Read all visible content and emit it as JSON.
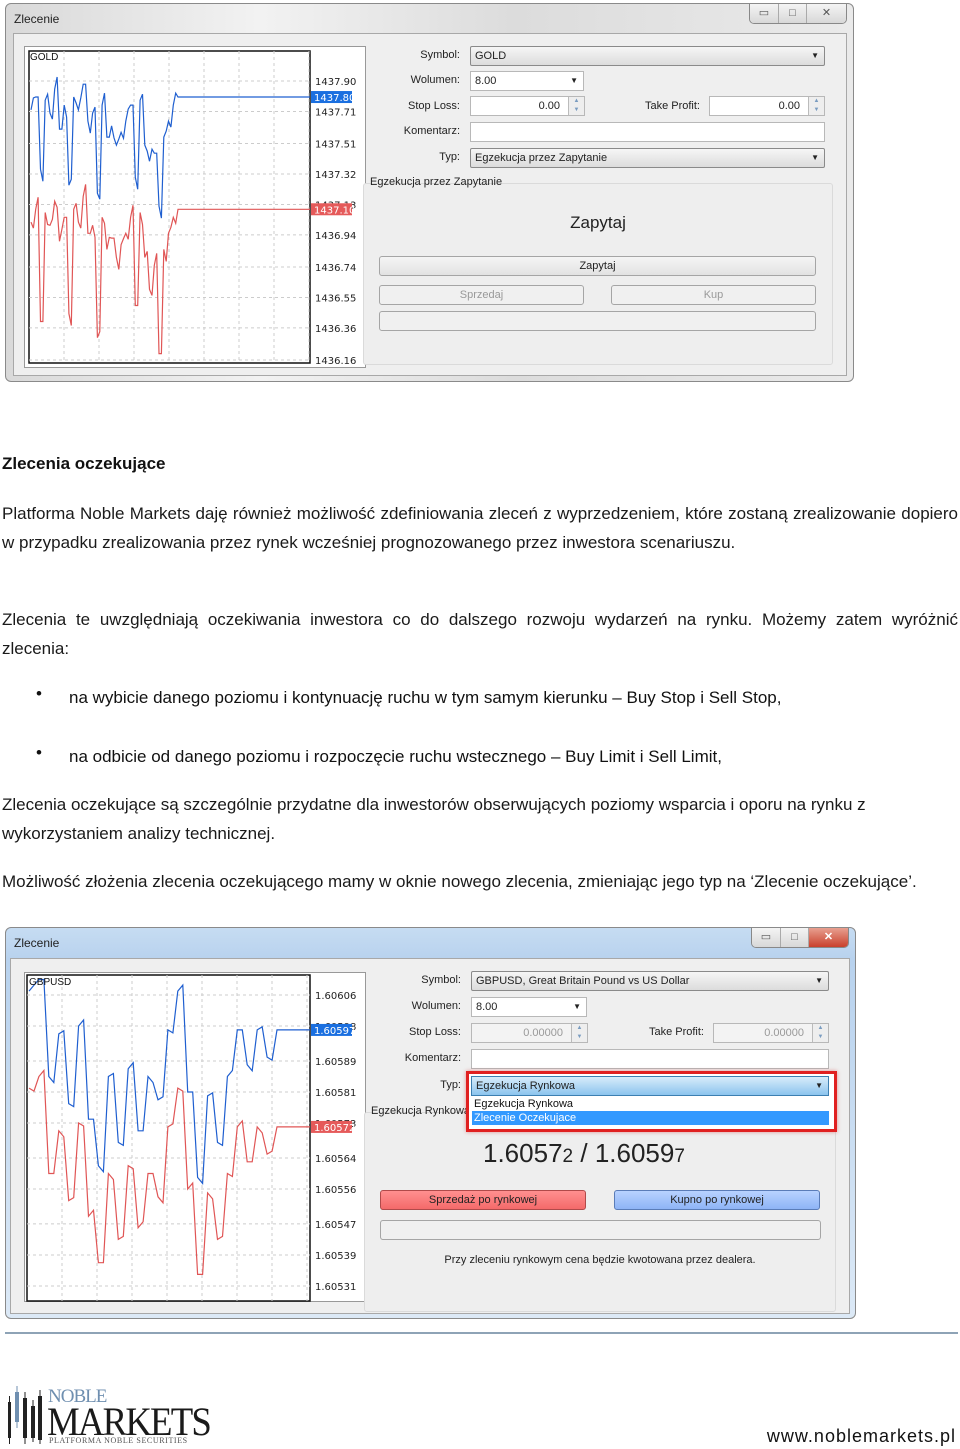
{
  "dialog1": {
    "title": "Zlecenie",
    "controls": {
      "minimize": "▭",
      "maximize": "□",
      "close": "✕"
    },
    "chart": {
      "symbol": "GOLD",
      "price_ticks": [
        "1437.90",
        "1437.71",
        "1437.51",
        "1437.32",
        "1437.13",
        "1436.94",
        "1436.74",
        "1436.55",
        "1436.36",
        "1436.16"
      ],
      "ask_label": "1437.80",
      "bid_label": "1437.10"
    },
    "form": {
      "symbol_label": "Symbol:",
      "symbol_value": "GOLD",
      "volume_label": "Wolumen:",
      "volume_value": "8.00",
      "stop_loss_label": "Stop Loss:",
      "stop_loss_value": "0.00",
      "take_profit_label": "Take Profit:",
      "take_profit_value": "0.00",
      "comment_label": "Komentarz:",
      "comment_value": "",
      "type_label": "Typ:",
      "type_value": "Egzekucja przez Zapytanie"
    },
    "group_label": "Egzekucja przez Zapytanie",
    "big_label": "Zapytaj",
    "request_button": "Zapytaj",
    "sell_button": "Sprzedaj",
    "buy_button": "Kup"
  },
  "article": {
    "heading": "Zlecenia oczekujące",
    "p1": "Platforma Noble Markets daję również możliwość zdefiniowania zleceń z wyprzedzeniem, które zostaną zrealizowanie dopiero w przypadku zrealizowania przez rynek wcześniej prognozowanego przez inwestora scenariuszu.",
    "p2": "Zlecenia te uwzględniają oczekiwania inwestora co do dalszego rozwoju wydarzeń na rynku. Możemy zatem wyróżnić zlecenia:",
    "bullets": [
      "na wybicie danego poziomu i kontynuację ruchu w tym samym kierunku – Buy Stop i Sell Stop,",
      "na odbicie  od danego poziomu i rozpoczęcie ruchu wstecznego – Buy Limit i Sell Limit,"
    ],
    "p3": "Zlecenia oczekujące są szczególnie przydatne dla inwestorów obserwujących  poziomy wsparcia i oporu na rynku z wykorzystaniem analizy technicznej.",
    "p4": "Możliwość złożenia zlecenia oczekującego mamy w oknie nowego zlecenia, zmieniając jego typ na ‘Zlecenie oczekujące’."
  },
  "dialog2": {
    "title": "Zlecenie",
    "controls": {
      "minimize": "▭",
      "maximize": "□",
      "close": "✕"
    },
    "chart": {
      "symbol": "GBPUSD",
      "price_ticks": [
        "1.60606",
        "1.60598",
        "1.60589",
        "1.60581",
        "1.60573",
        "1.60564",
        "1.60556",
        "1.60547",
        "1.60539",
        "1.60531"
      ],
      "ask_label": "1.60597",
      "bid_label": "1.60572"
    },
    "form": {
      "symbol_label": "Symbol:",
      "symbol_value": "GBPUSD, Great Britain Pound vs US Dollar",
      "volume_label": "Wolumen:",
      "volume_value": "8.00",
      "stop_loss_label": "Stop Loss:",
      "stop_loss_value": "0.00000",
      "take_profit_label": "Take Profit:",
      "take_profit_value": "0.00000",
      "comment_label": "Komentarz:",
      "comment_value": "",
      "type_label": "Typ:",
      "type_value": "Egzekucja Rynkowa",
      "type_options": [
        "Egzekucja Rynkowa",
        "Zlecenie Oczekujace"
      ],
      "type_highlighted": "Zlecenie Oczekujace"
    },
    "group_label": "Egzekucja Rynkowa",
    "bid_price_main": "1.6057",
    "bid_price_small": "2",
    "separator": "/",
    "ask_price_main": "1.6059",
    "ask_price_small": "7",
    "sell_button": "Sprzedaż po rynkowej",
    "buy_button": "Kupno po rynkowej",
    "note": "Przy zleceniu rynkowym cena będzie kwotowana przez dealera.",
    "highlight_color": "#e02020"
  },
  "chart_data": [
    {
      "type": "line",
      "title": "GOLD",
      "ylim": [
        1436.16,
        1437.9
      ],
      "series": [
        {
          "values": [
            1437.72,
            1437.8,
            1437.35,
            1437.78,
            1437.7,
            1437.85,
            1437.6,
            1437.75,
            1437.25,
            1437.8,
            1437.72,
            1437.88,
            1437.65,
            1437.7,
            1437.2,
            1437.75,
            1437.55,
            1437.62,
            1437.5,
            1437.58,
            1437.65,
            1437.75,
            1437.3,
            1437.78,
            1437.5,
            1437.4,
            1437.45,
            1437.12,
            1437.55,
            1437.65,
            1437.75,
            1437.8
          ]
        },
        {
          "values": [
            1437.02,
            1437.1,
            1436.4,
            1437.08,
            1437.0,
            1437.15,
            1436.9,
            1437.05,
            1436.45,
            1437.1,
            1437.02,
            1437.18,
            1436.95,
            1437.0,
            1436.3,
            1437.05,
            1436.85,
            1436.92,
            1436.8,
            1436.88,
            1436.95,
            1437.05,
            1436.5,
            1437.08,
            1436.8,
            1436.6,
            1436.75,
            1436.2,
            1436.85,
            1436.95,
            1437.05,
            1437.1
          ]
        }
      ],
      "colors": [
        "#1f5fd0",
        "#e05555"
      ]
    },
    {
      "type": "line",
      "title": "GBPUSD",
      "ylim": [
        1.60531,
        1.60606
      ],
      "series": [
        {
          "values": [
            1.60607,
            1.6061,
            1.60585,
            1.60596,
            1.60578,
            1.60598,
            1.60574,
            1.60562,
            1.60585,
            1.60568,
            1.60587,
            1.60571,
            1.60585,
            1.60579,
            1.60597,
            1.60607,
            1.60581,
            1.60559,
            1.6058,
            1.60568,
            1.60585,
            1.60597,
            1.60588,
            1.60597,
            1.6059,
            1.60597
          ]
        },
        {
          "values": [
            1.60582,
            1.60585,
            1.6056,
            1.60571,
            1.60553,
            1.60573,
            1.60549,
            1.60537,
            1.6056,
            1.60543,
            1.60562,
            1.60546,
            1.6056,
            1.60554,
            1.60572,
            1.60582,
            1.60556,
            1.60534,
            1.60555,
            1.60543,
            1.6056,
            1.60572,
            1.60563,
            1.60572,
            1.60565,
            1.60572
          ]
        }
      ],
      "colors": [
        "#1f5fd0",
        "#e05555"
      ]
    }
  ],
  "footer": {
    "logo_top": "NOBLE",
    "logo_main": "MARKETS",
    "logo_sub": "PLATFORMA NOBLE SECURITIES",
    "url": "www.noblemarkets.pl"
  }
}
